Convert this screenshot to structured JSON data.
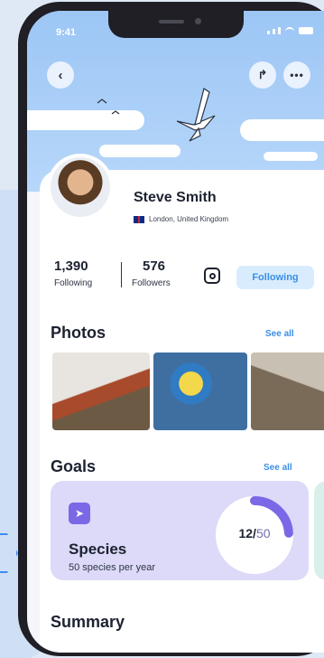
{
  "status_bar": {
    "time": "9:41"
  },
  "profile": {
    "name": "Steve Smith",
    "location": "London, United Kingdom",
    "following_count": "1,390",
    "following_label": "Following",
    "followers_count": "576",
    "followers_label": "Followers",
    "follow_button_label": "Following"
  },
  "photos": {
    "title": "Photos",
    "see_all": "See all",
    "items": [
      "robin",
      "blue-tit",
      "long-tailed-tit"
    ]
  },
  "goals": {
    "title": "Goals",
    "see_all": "See all",
    "card": {
      "title": "Species",
      "subtitle": "50 species per year",
      "current": "12",
      "separator": "/",
      "total": "50",
      "progress": 0.24
    }
  },
  "summary": {
    "title": "Summary"
  },
  "colors": {
    "accent_blue": "#3b8fe6",
    "goal_card": "#dcdaf8",
    "goal_ring": "#7b68e6",
    "sky": "#9cc6f5"
  },
  "icons": [
    "back-icon",
    "share-icon",
    "more-icon",
    "instagram-icon",
    "bird-icon"
  ]
}
